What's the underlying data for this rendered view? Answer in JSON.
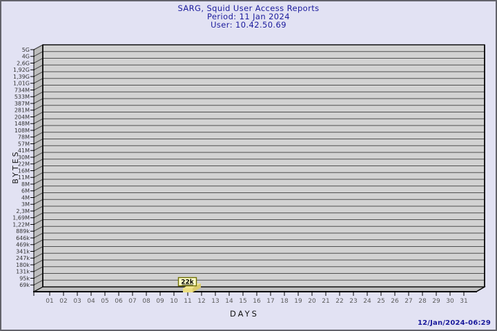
{
  "window": {
    "bg_color": "#E2E2F3",
    "frame_color": "#63636B"
  },
  "header": {
    "title": "SARG, Squid User Access Reports",
    "period": "Period: 11 Jan 2024",
    "user": "User: 10.42.50.69",
    "text_color": "#1A1A9C"
  },
  "footer": {
    "timestamp": "12/Jan/2024-06:29"
  },
  "chart_data": {
    "type": "bar",
    "title": "SARG, Squid User Access Reports",
    "subtitle": "Period: 11 Jan 2024",
    "subtitle2": "User: 10.42.50.69",
    "xlabel": "DAYS",
    "ylabel": "BYTES",
    "y_scale": "log-like (SARG byte scale)",
    "y_tick_labels": [
      "5G",
      "4G",
      "2,6G",
      "1,92G",
      "1,39G",
      "1,01G",
      "734M",
      "533M",
      "387M",
      "281M",
      "204M",
      "148M",
      "108M",
      "78M",
      "57M",
      "41M",
      "30M",
      "22M",
      "16M",
      "11M",
      "8M",
      "6M",
      "4M",
      "3M",
      "2,3M",
      "1,69M",
      "1,22M",
      "889k",
      "646k",
      "469k",
      "341k",
      "247k",
      "180k",
      "131k",
      "95k",
      "69k"
    ],
    "x_tick_labels": [
      "01",
      "02",
      "03",
      "04",
      "05",
      "06",
      "07",
      "08",
      "09",
      "10",
      "11",
      "12",
      "13",
      "14",
      "15",
      "16",
      "17",
      "18",
      "19",
      "20",
      "21",
      "22",
      "23",
      "24",
      "25",
      "26",
      "27",
      "28",
      "29",
      "30",
      "31"
    ],
    "bars": [
      {
        "day": 11,
        "label": "22k"
      }
    ],
    "legend": "none",
    "grid": "horizontal",
    "colors": {
      "plot_bg": "#D2D2D2",
      "wall": "#BDBDBD",
      "grid_line": "#4F4F4F",
      "axis_line": "#000000",
      "y_tick_text": "#333333",
      "x_tick_text": "#5A5A5A",
      "axis_title_text": "#111111",
      "bar_top": "#F2E795",
      "bar_front": "#EBDE80",
      "bar_side": "#D9CA6C",
      "callout_bg": "#FFFFC8",
      "callout_border": "#6E6E00",
      "callout_text": "#000000"
    }
  }
}
